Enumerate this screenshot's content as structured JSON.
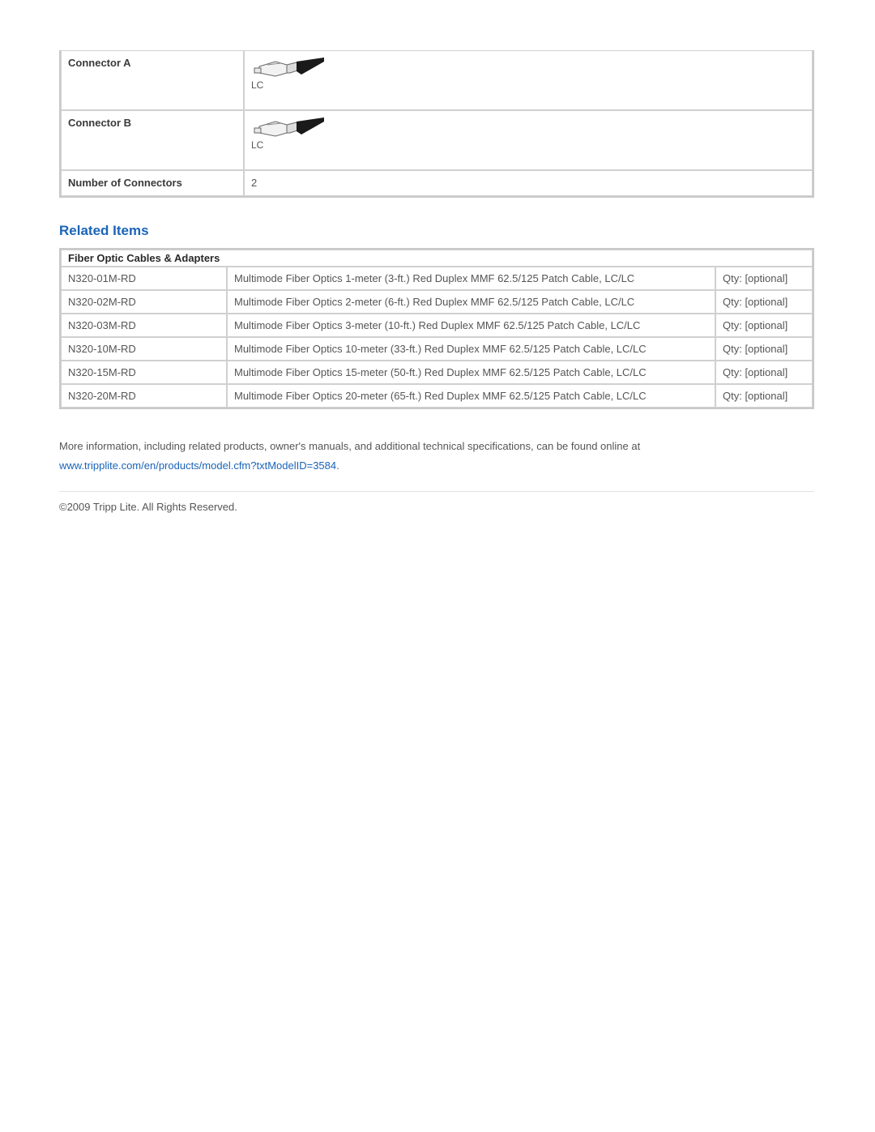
{
  "spec": {
    "connector_a_label": "Connector A",
    "connector_a_type": "LC",
    "connector_b_label": "Connector B",
    "connector_b_type": "LC",
    "num_connectors_label": "Number of Connectors",
    "num_connectors_value": "2"
  },
  "related": {
    "heading": "Related Items",
    "category": "Fiber Optic Cables & Adapters",
    "rows": [
      {
        "sku": "N320-01M-RD",
        "desc": "Multimode Fiber Optics 1-meter (3-ft.) Red Duplex MMF 62.5/125 Patch Cable, LC/LC",
        "qty": "Qty: [optional]"
      },
      {
        "sku": "N320-02M-RD",
        "desc": "Multimode Fiber Optics 2-meter (6-ft.) Red Duplex MMF 62.5/125 Patch Cable, LC/LC",
        "qty": "Qty: [optional]"
      },
      {
        "sku": "N320-03M-RD",
        "desc": "Multimode Fiber Optics 3-meter (10-ft.) Red Duplex MMF 62.5/125 Patch Cable, LC/LC",
        "qty": "Qty: [optional]"
      },
      {
        "sku": "N320-10M-RD",
        "desc": "Multimode Fiber Optics 10-meter (33-ft.) Red Duplex MMF 62.5/125 Patch Cable, LC/LC",
        "qty": "Qty: [optional]"
      },
      {
        "sku": "N320-15M-RD",
        "desc": "Multimode Fiber Optics 15-meter (50-ft.) Red Duplex MMF 62.5/125 Patch Cable, LC/LC",
        "qty": "Qty: [optional]"
      },
      {
        "sku": "N320-20M-RD",
        "desc": "Multimode Fiber Optics 20-meter (65-ft.) Red Duplex MMF 62.5/125 Patch Cable, LC/LC",
        "qty": "Qty: [optional]"
      }
    ]
  },
  "footer": {
    "more_info": "More information, including related products, owner's manuals, and additional technical specifications, can be found online at",
    "url": "www.tripplite.com/en/products/model.cfm?txtModelID=3584",
    "url_suffix": ".",
    "copyright": "©2009 Tripp Lite.  All Rights Reserved."
  },
  "colors": {
    "link": "#1a64b8",
    "border": "#c9c9c9"
  }
}
